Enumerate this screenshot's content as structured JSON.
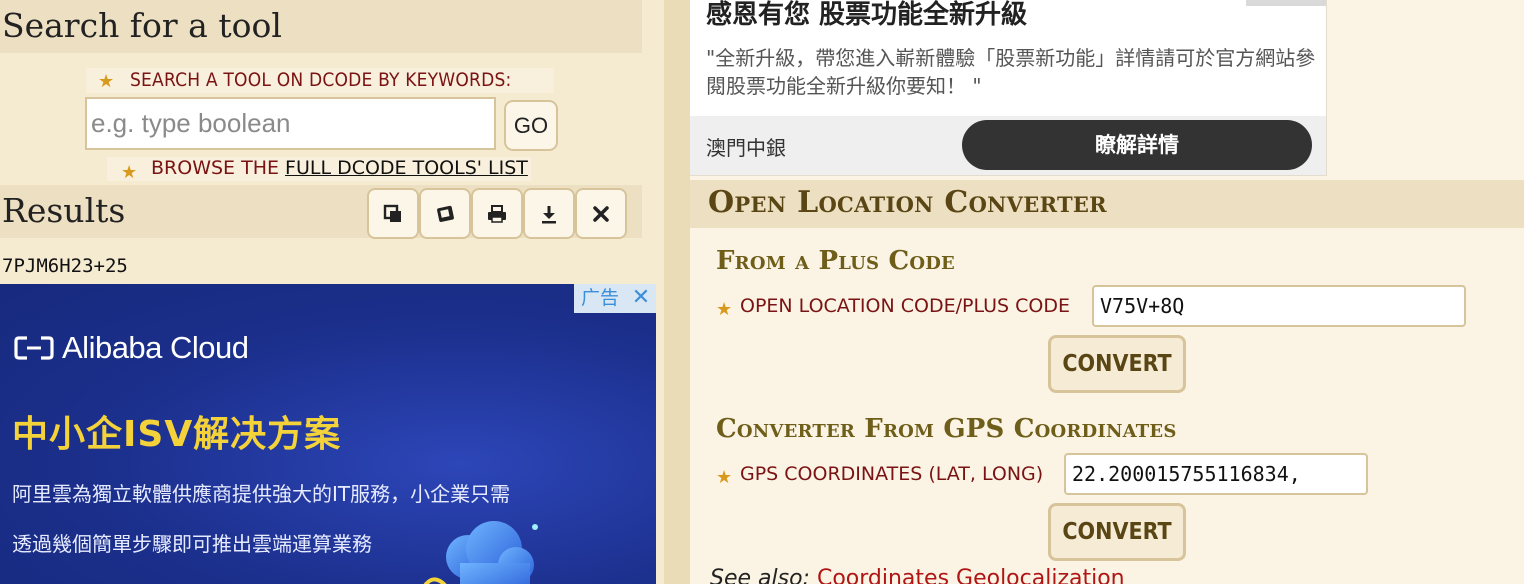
{
  "search": {
    "title": "Search for a tool",
    "keywords_label": "SEARCH A TOOL ON DCODE BY KEYWORDS:",
    "placeholder": "e.g. type boolean",
    "go_label": "GO",
    "browse_prefix": "BROWSE THE ",
    "browse_link": "FULL DCODE TOOLS' LIST"
  },
  "results": {
    "title": "Results",
    "value": "7PJM6H23+25",
    "toolbar": [
      {
        "name": "copy-icon"
      },
      {
        "name": "mobile-icon"
      },
      {
        "name": "print-icon"
      },
      {
        "name": "download-icon"
      },
      {
        "name": "close-icon"
      }
    ]
  },
  "ad_left": {
    "badge": "广告",
    "brand": "Alibaba Cloud",
    "headline": "中小企ISV解决方案",
    "line1": "阿里雲為獨立軟體供應商提供強大的IT服務，小企業只需",
    "line2": "透過幾個簡單步驟即可推出雲端運算業務"
  },
  "ad_right": {
    "title": "感恩有您 股票功能全新升級",
    "description": "\"全新升級，帶您進入嶄新體驗「股票新功能」詳情請可於官方網站參閱股票功能全新升級你要知！ \"",
    "sponsor": "澳門中銀",
    "cta": "瞭解詳情"
  },
  "tool": {
    "title": "Open Location Converter",
    "from_plus": {
      "title": "From a Plus Code",
      "label": "OPEN LOCATION CODE/PLUS CODE",
      "value": "V75V+8Q",
      "button": "CONVERT"
    },
    "from_gps": {
      "title": "Converter From GPS Coordinates",
      "label": "GPS COORDINATES (LAT, LONG)",
      "value": "22.200015755116834,",
      "button": "CONVERT"
    },
    "see_also_label": "See also:",
    "see_also_link": "Coordinates Geolocalization"
  },
  "colors": {
    "background": "#f5ebd1",
    "label_red": "#7a1313",
    "heading_olive": "#6e5e1a",
    "ad_blue": "#1b2f8c"
  }
}
